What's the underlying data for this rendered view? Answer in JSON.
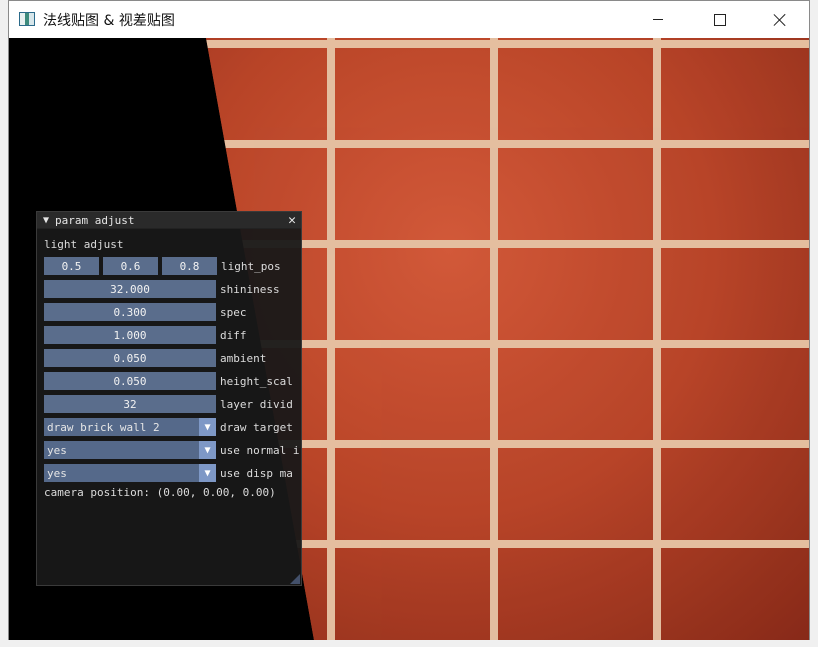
{
  "window": {
    "title": "法线贴图 & 视差贴图"
  },
  "panel": {
    "title": "param adjust",
    "section": "light adjust",
    "light_pos": {
      "values": [
        "0.5",
        "0.6",
        "0.8"
      ],
      "label": "light_pos"
    },
    "shininess": {
      "value": "32.000",
      "label": "shininess"
    },
    "spec": {
      "value": "0.300",
      "label": "spec"
    },
    "diff": {
      "value": "1.000",
      "label": "diff"
    },
    "ambient": {
      "value": "0.050",
      "label": "ambient"
    },
    "height_scale": {
      "value": "0.050",
      "label": "height_scal"
    },
    "layer_divide": {
      "value": "32",
      "label": "layer divid"
    },
    "draw_target": {
      "value": "draw brick wall 2",
      "label": "draw target"
    },
    "use_normal": {
      "value": "yes",
      "label": "use normal i"
    },
    "use_disp": {
      "value": "yes",
      "label": "use disp ma"
    },
    "camera_position": "camera position: (0.00, 0.00, 0.00)"
  }
}
